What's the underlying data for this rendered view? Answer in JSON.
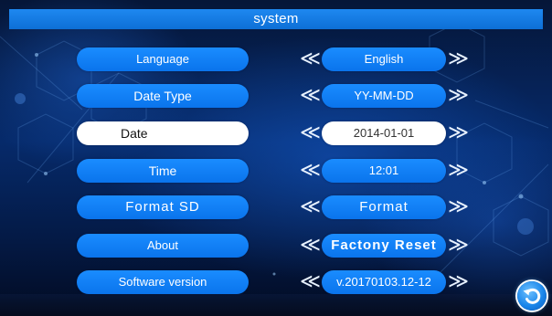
{
  "title": "system",
  "rows": [
    {
      "label": "Language",
      "value": "English"
    },
    {
      "label": "Date Type",
      "value": "YY-MM-DD"
    },
    {
      "label": "Date",
      "value": "2014-01-01"
    },
    {
      "label": "Time",
      "value": "12:01"
    },
    {
      "label": "Format SD",
      "value": "Format"
    },
    {
      "label": "About",
      "value": "Factony Reset"
    },
    {
      "label": "Software version",
      "value": "v.20170103.12-12"
    }
  ],
  "arrows": {
    "left": "≪",
    "right": "≫"
  },
  "colors": {
    "accent": "#1a8cff",
    "title_bar": "#1e88f0",
    "selected": "#ffffff"
  },
  "icons": {
    "back": "back-icon"
  }
}
